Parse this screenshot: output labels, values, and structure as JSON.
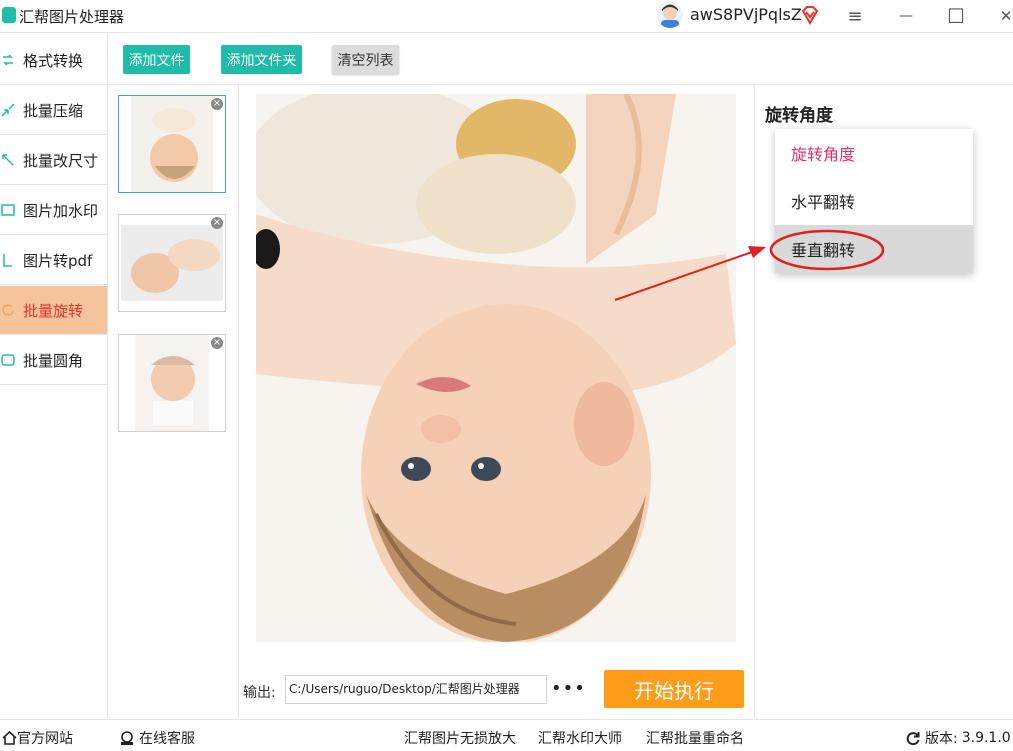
{
  "app": {
    "title": "汇帮图片处理器",
    "username": "awS8PVjPqlsZ"
  },
  "window_controls": {
    "menu": "≡",
    "minimize": "—",
    "maximize": "☐",
    "close": "✕"
  },
  "sidebar": {
    "items": [
      {
        "label": "格式转换",
        "icon": "format-convert-icon"
      },
      {
        "label": "批量压缩",
        "icon": "compress-icon"
      },
      {
        "label": "批量改尺寸",
        "icon": "resize-icon"
      },
      {
        "label": "图片加水印",
        "icon": "watermark-icon"
      },
      {
        "label": "图片转pdf",
        "icon": "pdf-icon"
      },
      {
        "label": "批量旋转",
        "icon": "rotate-icon",
        "active": true
      },
      {
        "label": "批量圆角",
        "icon": "round-corner-icon"
      }
    ]
  },
  "toolbar": {
    "add_file": "添加文件",
    "add_folder": "添加文件夹",
    "clear_list": "清空列表"
  },
  "right_panel": {
    "title": "旋转角度",
    "options": [
      {
        "label": "旋转角度",
        "color": "#e0336c"
      },
      {
        "label": "水平翻转"
      },
      {
        "label": "垂直翻转",
        "highlighted": true
      }
    ]
  },
  "output": {
    "label": "输出:",
    "path": "C:/Users/ruguo/Desktop/汇帮图片处理器",
    "more": "•••"
  },
  "start_button": "开始执行",
  "footer": {
    "website": "官方网站",
    "support": "在线客服",
    "links": [
      "汇帮图片无损放大",
      "汇帮水印大师",
      "汇帮批量重命名"
    ],
    "version_label": "版本:",
    "version": "3.9.1.0"
  },
  "colors": {
    "accent_green": "#1fbda7",
    "active_bg": "#f6c49b",
    "active_text": "#e8332a",
    "start_orange": "#ff9c1a",
    "annotation_red": "#e02020"
  }
}
